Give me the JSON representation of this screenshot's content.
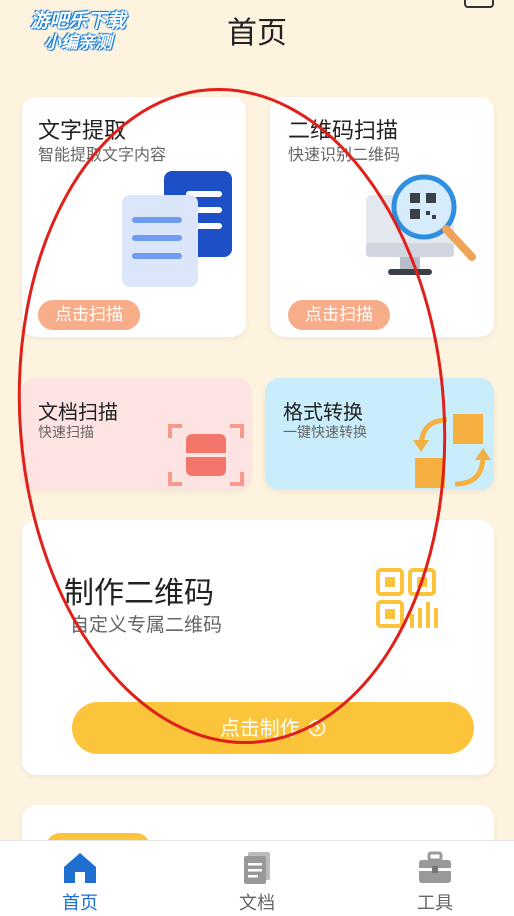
{
  "watermark": {
    "line1": "游吧乐下载",
    "line2": "小编亲测"
  },
  "header": {
    "title": "首页"
  },
  "cards": {
    "text_extract": {
      "title": "文字提取",
      "subtitle": "智能提取文字内容",
      "button": "点击扫描"
    },
    "qr_scan": {
      "title": "二维码扫描",
      "subtitle": "快速识别二维码",
      "button": "点击扫描"
    },
    "doc_scan": {
      "title": "文档扫描",
      "subtitle": "快速扫描"
    },
    "format_convert": {
      "title": "格式转换",
      "subtitle": "一键快速转换"
    },
    "make_qr": {
      "title": "制作二维码",
      "subtitle": "自定义专属二维码",
      "button": "点击制作",
      "button_icon": "arrow-right-circle-icon"
    }
  },
  "tabbar": {
    "items": [
      {
        "label": "首页",
        "icon": "home-icon",
        "active": true
      },
      {
        "label": "文档",
        "icon": "document-icon",
        "active": false
      },
      {
        "label": "工具",
        "icon": "toolbox-icon",
        "active": false
      }
    ]
  },
  "colors": {
    "background": "#fdf3df",
    "scan_pill": "#f7ad8a",
    "make_button": "#fbc43a",
    "doc_scan_bg": "#fde3e2",
    "format_bg": "#c9edfa",
    "tab_active": "#1e6fd0",
    "tab_inactive": "#888888",
    "annotation": "#e0201a"
  }
}
